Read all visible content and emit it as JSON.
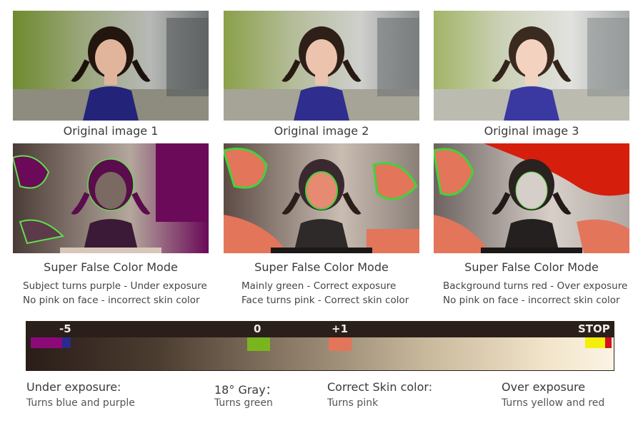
{
  "panels": [
    {
      "caption": "Original image 1",
      "mode_title": "Super False Color Mode",
      "desc_line1": "Subject turns purple - Under exposure",
      "desc_line2": "No pink on face - incorrect skin color"
    },
    {
      "caption": "Original image 2",
      "mode_title": "Super False Color Mode",
      "desc_line1": "Mainly green - Correct exposure",
      "desc_line2": "Face turns pink - Correct skin color"
    },
    {
      "caption": "Original image 3",
      "mode_title": "Super False Color Mode",
      "desc_line1": "Background turns red - Over exposure",
      "desc_line2": "No pink on face - incorrect skin color"
    }
  ],
  "scale": {
    "labels": {
      "minus5": "-5",
      "zero": "0",
      "plus1": "+1",
      "stop": "STOP"
    },
    "colors": {
      "purple": "#8b0a78",
      "blue": "#2a2a8c",
      "green": "#7ab51d",
      "pink": "#e3755b",
      "yellow": "#f4ef0a",
      "red": "#d4101e"
    }
  },
  "legend": [
    {
      "title": "Under exposure:",
      "sub": "Turns blue and purple"
    },
    {
      "title": "18° Gray：",
      "sub": "Turns green"
    },
    {
      "title": "Correct Skin color:",
      "sub": "Turns pink"
    },
    {
      "title": "Over exposure",
      "sub": "Turns yellow and red"
    }
  ]
}
